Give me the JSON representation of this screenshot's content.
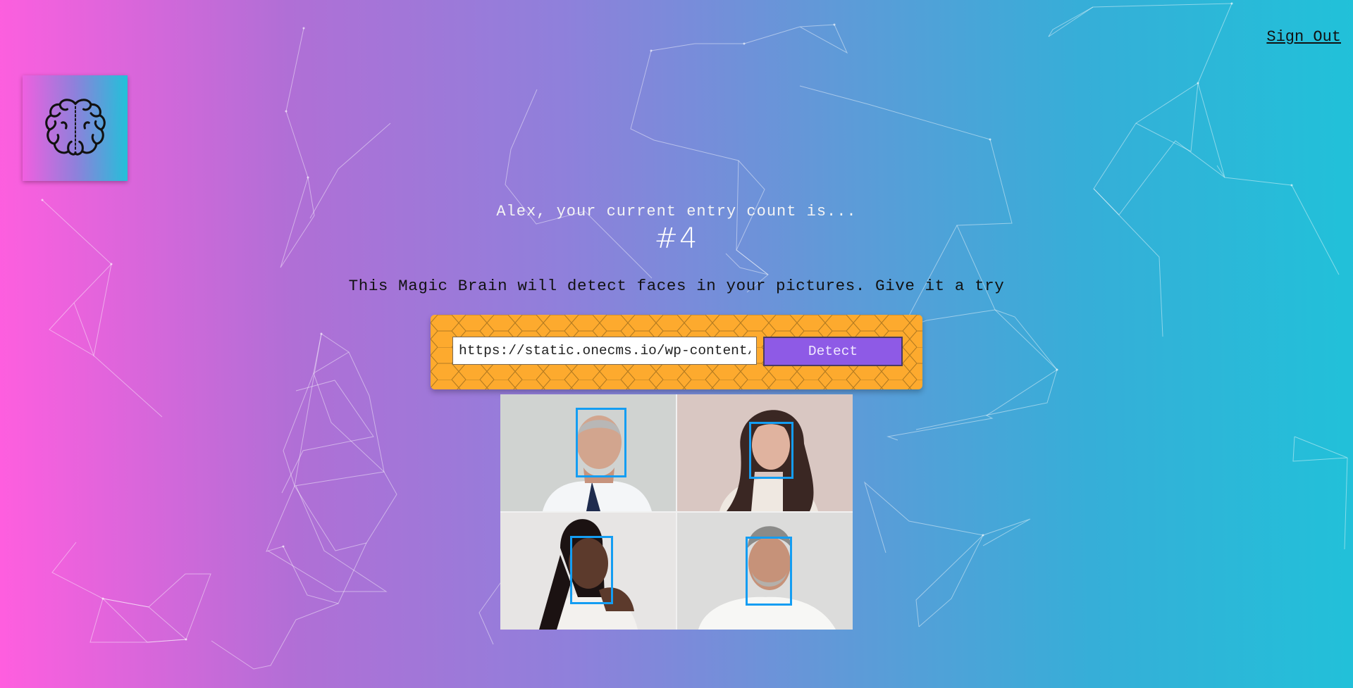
{
  "nav": {
    "sign_out_label": "Sign Out"
  },
  "logo": {
    "icon": "brain-icon"
  },
  "rank": {
    "message": "Alex, your current entry count is...",
    "count": "#4"
  },
  "description": "This Magic Brain will detect faces in your pictures. Give it a try",
  "image_form": {
    "url_value": "https://static.onecms.io/wp-content/",
    "detect_label": "Detect"
  },
  "colors": {
    "gradient_start": "#ff5edf",
    "gradient_end": "#21c1d9",
    "form_panel": "#fdaa2e",
    "detect_button": "#8e5ae6",
    "face_box": "#149df2"
  },
  "faces_detected": 4
}
